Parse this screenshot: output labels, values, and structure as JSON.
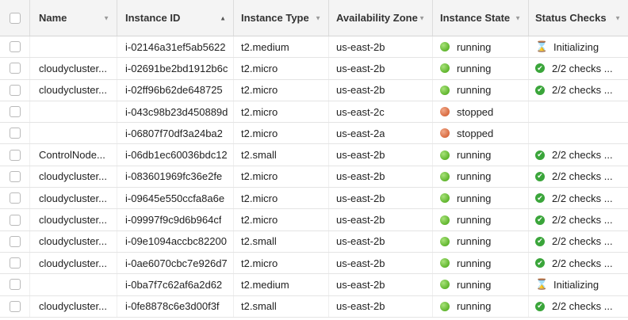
{
  "columns": {
    "name": "Name",
    "instance_id": "Instance ID",
    "instance_type": "Instance Type",
    "availability_zone": "Availability Zone",
    "instance_state": "Instance State",
    "status_checks": "Status Checks"
  },
  "sort_column": "instance_id",
  "colors": {
    "running": "#5fb52c",
    "stopped": "#d96a3f",
    "check_ok": "#3aa53a"
  },
  "rows": [
    {
      "name": "",
      "id": "i-02146a31ef5ab5622",
      "type": "t2.medium",
      "az": "us-east-2b",
      "state": "running",
      "status": "Initializing",
      "status_icon": "hourglass-icon"
    },
    {
      "name": "cloudycluster...",
      "id": "i-02691be2bd1912b6c",
      "type": "t2.micro",
      "az": "us-east-2b",
      "state": "running",
      "status": "2/2 checks ...",
      "status_icon": "check-icon"
    },
    {
      "name": "cloudycluster...",
      "id": "i-02ff96b62de648725",
      "type": "t2.micro",
      "az": "us-east-2b",
      "state": "running",
      "status": "2/2 checks ...",
      "status_icon": "check-icon"
    },
    {
      "name": "",
      "id": "i-043c98b23d450889d",
      "type": "t2.micro",
      "az": "us-east-2c",
      "state": "stopped",
      "status": "",
      "status_icon": ""
    },
    {
      "name": "",
      "id": "i-06807f70df3a24ba2",
      "type": "t2.micro",
      "az": "us-east-2a",
      "state": "stopped",
      "status": "",
      "status_icon": ""
    },
    {
      "name": "ControlNode...",
      "id": "i-06db1ec60036bdc12",
      "type": "t2.small",
      "az": "us-east-2b",
      "state": "running",
      "status": "2/2 checks ...",
      "status_icon": "check-icon"
    },
    {
      "name": "cloudycluster...",
      "id": "i-083601969fc36e2fe",
      "type": "t2.micro",
      "az": "us-east-2b",
      "state": "running",
      "status": "2/2 checks ...",
      "status_icon": "check-icon"
    },
    {
      "name": "cloudycluster...",
      "id": "i-09645e550ccfa8a6e",
      "type": "t2.micro",
      "az": "us-east-2b",
      "state": "running",
      "status": "2/2 checks ...",
      "status_icon": "check-icon"
    },
    {
      "name": "cloudycluster...",
      "id": "i-09997f9c9d6b964cf",
      "type": "t2.micro",
      "az": "us-east-2b",
      "state": "running",
      "status": "2/2 checks ...",
      "status_icon": "check-icon"
    },
    {
      "name": "cloudycluster...",
      "id": "i-09e1094accbc82200",
      "type": "t2.small",
      "az": "us-east-2b",
      "state": "running",
      "status": "2/2 checks ...",
      "status_icon": "check-icon"
    },
    {
      "name": "cloudycluster...",
      "id": "i-0ae6070cbc7e926d7",
      "type": "t2.micro",
      "az": "us-east-2b",
      "state": "running",
      "status": "2/2 checks ...",
      "status_icon": "check-icon"
    },
    {
      "name": "",
      "id": "i-0ba7f7c62af6a2d62",
      "type": "t2.medium",
      "az": "us-east-2b",
      "state": "running",
      "status": "Initializing",
      "status_icon": "hourglass-icon"
    },
    {
      "name": "cloudycluster...",
      "id": "i-0fe8878c6e3d00f3f",
      "type": "t2.small",
      "az": "us-east-2b",
      "state": "running",
      "status": "2/2 checks ...",
      "status_icon": "check-icon"
    }
  ]
}
